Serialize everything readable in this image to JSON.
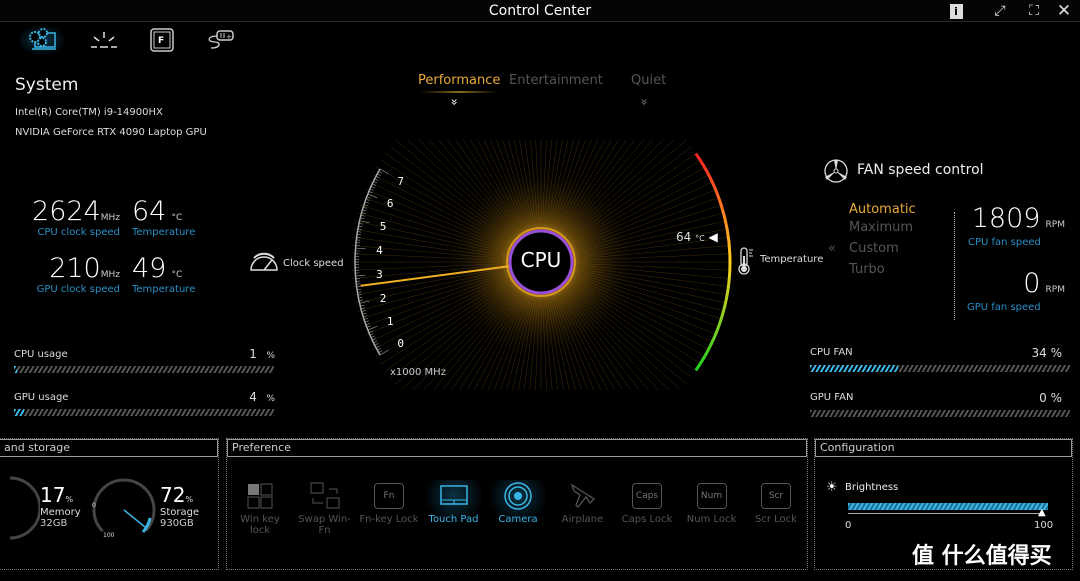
{
  "window": {
    "title": "Control Center",
    "buttons": [
      "info",
      "restore",
      "fullscreen",
      "close"
    ]
  },
  "tabs": [
    {
      "icon": "system-gear-icon",
      "active": true
    },
    {
      "icon": "lighting-icon"
    },
    {
      "icon": "function-key-icon"
    },
    {
      "icon": "battery-charge-icon"
    }
  ],
  "system": {
    "heading": "System",
    "cpu_name": "Intel(R) Core(TM) i9-14900HX",
    "gpu_name": "NVIDIA GeForce RTX 4090 Laptop GPU",
    "cpu_clock": "2624",
    "cpu_clock_unit": "MHz",
    "cpu_clock_label": "CPU clock speed",
    "cpu_temp": "64",
    "cpu_temp_unit": "°C",
    "cpu_temp_label": "Temperature",
    "gpu_clock": "210",
    "gpu_clock_unit": "MHz",
    "gpu_clock_label": "GPU clock speed",
    "gpu_temp": "49",
    "gpu_temp_unit": "°C",
    "gpu_temp_label": "Temperature"
  },
  "modes": {
    "items": [
      "Performance",
      "Entertainment",
      "Quiet"
    ],
    "active": "Performance"
  },
  "gauge": {
    "center_label": "CPU",
    "clock_label": "Clock speed",
    "scale": [
      "0",
      "1",
      "2",
      "3",
      "4",
      "5",
      "6",
      "7"
    ],
    "scale_unit": "x1000 MHz",
    "clock_value_ghz": 2.624,
    "temp_value": "64",
    "temp_unit": "°C",
    "temp_label": "Temperature"
  },
  "usage": {
    "cpu_label": "CPU usage",
    "cpu_value": "1",
    "cpu_percent": 1,
    "gpu_label": "GPU usage",
    "gpu_value": "4",
    "gpu_percent": 4,
    "unit": "%"
  },
  "fan": {
    "heading": "FAN speed control",
    "options": [
      "Automatic",
      "Maximum",
      "Custom",
      "Turbo"
    ],
    "selected": "Automatic",
    "cpu_rpm": "1809",
    "gpu_rpm": "0",
    "rpm_unit": "RPM",
    "cpu_rpm_label": "CPU fan speed",
    "gpu_rpm_label": "GPU fan speed",
    "cpu_fan_label": "CPU FAN",
    "cpu_fan_value": "34 %",
    "cpu_fan_percent": 34,
    "gpu_fan_label": "GPU FAN",
    "gpu_fan_value": "0 %",
    "gpu_fan_percent": 0
  },
  "storage": {
    "heading": "and storage",
    "memory_percent": "17",
    "memory_pct_unit": "%",
    "memory_label": "Memory",
    "memory_size": "32GB",
    "storage_percent": "72",
    "storage_pct_unit": "%",
    "storage_label": "Storage",
    "storage_size": "930GB",
    "dial_min": "0",
    "dial_max": "100"
  },
  "preference": {
    "heading": "Preference",
    "items": [
      {
        "label": "Win key lock",
        "on": false
      },
      {
        "label": "Swap Win-Fn",
        "on": false
      },
      {
        "label": "Fn-key Lock",
        "on": false,
        "key": "Fn"
      },
      {
        "label": "Touch Pad",
        "on": true
      },
      {
        "label": "Camera",
        "on": true
      },
      {
        "label": "Airplane",
        "on": false
      },
      {
        "label": "Caps Lock",
        "on": false,
        "key": "Caps"
      },
      {
        "label": "Num Lock",
        "on": false,
        "key": "Num"
      },
      {
        "label": "Scr Lock",
        "on": false,
        "key": "Scr"
      }
    ]
  },
  "configuration": {
    "heading": "Configuration",
    "brightness_label": "Brightness",
    "brightness_value": 100,
    "min": "0",
    "max": "100"
  },
  "watermark": "值 什么值得买",
  "colors": {
    "accent": "#e8a93a",
    "blue": "#2a8fc6",
    "cyan": "#39b6e6",
    "purple": "#9a4fd8"
  }
}
